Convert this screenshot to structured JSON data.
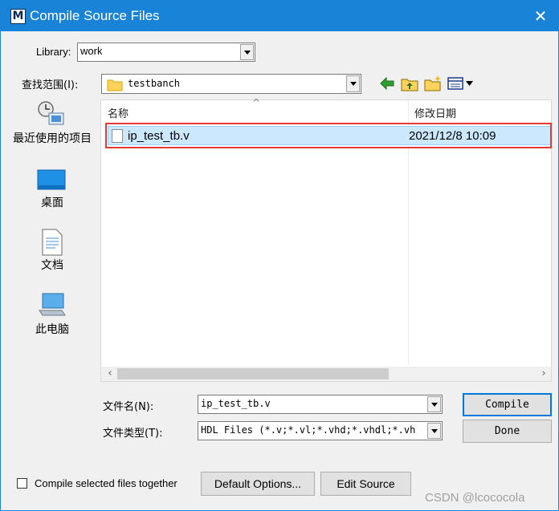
{
  "window": {
    "title": "Compile Source Files",
    "close_glyph": "✕",
    "app_icon_letter": "M"
  },
  "library": {
    "label": "Library:",
    "value": "work"
  },
  "lookin": {
    "label": "查找范围(I):",
    "value": "testbanch"
  },
  "toolbar_icons": [
    "back-arrow-icon",
    "up-folder-icon",
    "new-folder-icon",
    "view-menu-icon"
  ],
  "places": [
    {
      "label": "最近使用的项目",
      "icon": "recent-items-icon"
    },
    {
      "label": "桌面",
      "icon": "desktop-icon"
    },
    {
      "label": "文档",
      "icon": "documents-icon"
    },
    {
      "label": "此电脑",
      "icon": "this-pc-icon"
    }
  ],
  "filelist": {
    "col_name": "名称",
    "col_modified": "修改日期",
    "sort_glyph": "^",
    "rows": [
      {
        "name": "ip_test_tb.v",
        "modified": "2021/12/8 10:09"
      }
    ]
  },
  "filename": {
    "label": "文件名(N):",
    "value": "ip_test_tb.v"
  },
  "filetype": {
    "label": "文件类型(T):",
    "value": "HDL Files (*.v;*.vl;*.vhd;*.vhdl;*.vh"
  },
  "buttons": {
    "compile": "Compile",
    "done": "Done",
    "default_options": "Default Options...",
    "edit_source": "Edit Source"
  },
  "compile_together": {
    "label": "Compile selected files together",
    "checked": false
  },
  "watermark": "CSDN @lcococola",
  "colors": {
    "title_bar": "#1883d7",
    "selection": "#cce8ff",
    "highlight_outline": "#e53935"
  }
}
